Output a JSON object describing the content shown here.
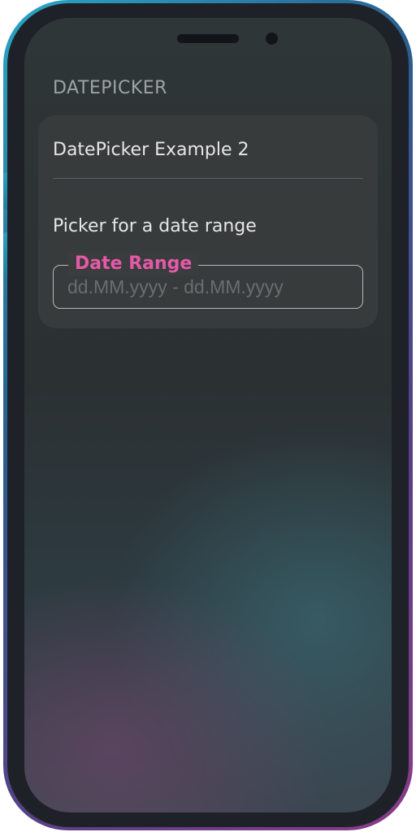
{
  "screen": {
    "section_title": "DATEPICKER"
  },
  "card": {
    "title": "DatePicker Example 2",
    "picker_label": "Picker for a date range",
    "field": {
      "label": "Date Range",
      "placeholder": "dd.MM.yyyy - dd.MM.yyyy",
      "value": ""
    }
  },
  "colors": {
    "accent": "#e55aa8",
    "card_bg": "#3a3c3e",
    "frame_gradient_start": "#2aa6c4",
    "frame_gradient_end": "#8a3c88"
  }
}
